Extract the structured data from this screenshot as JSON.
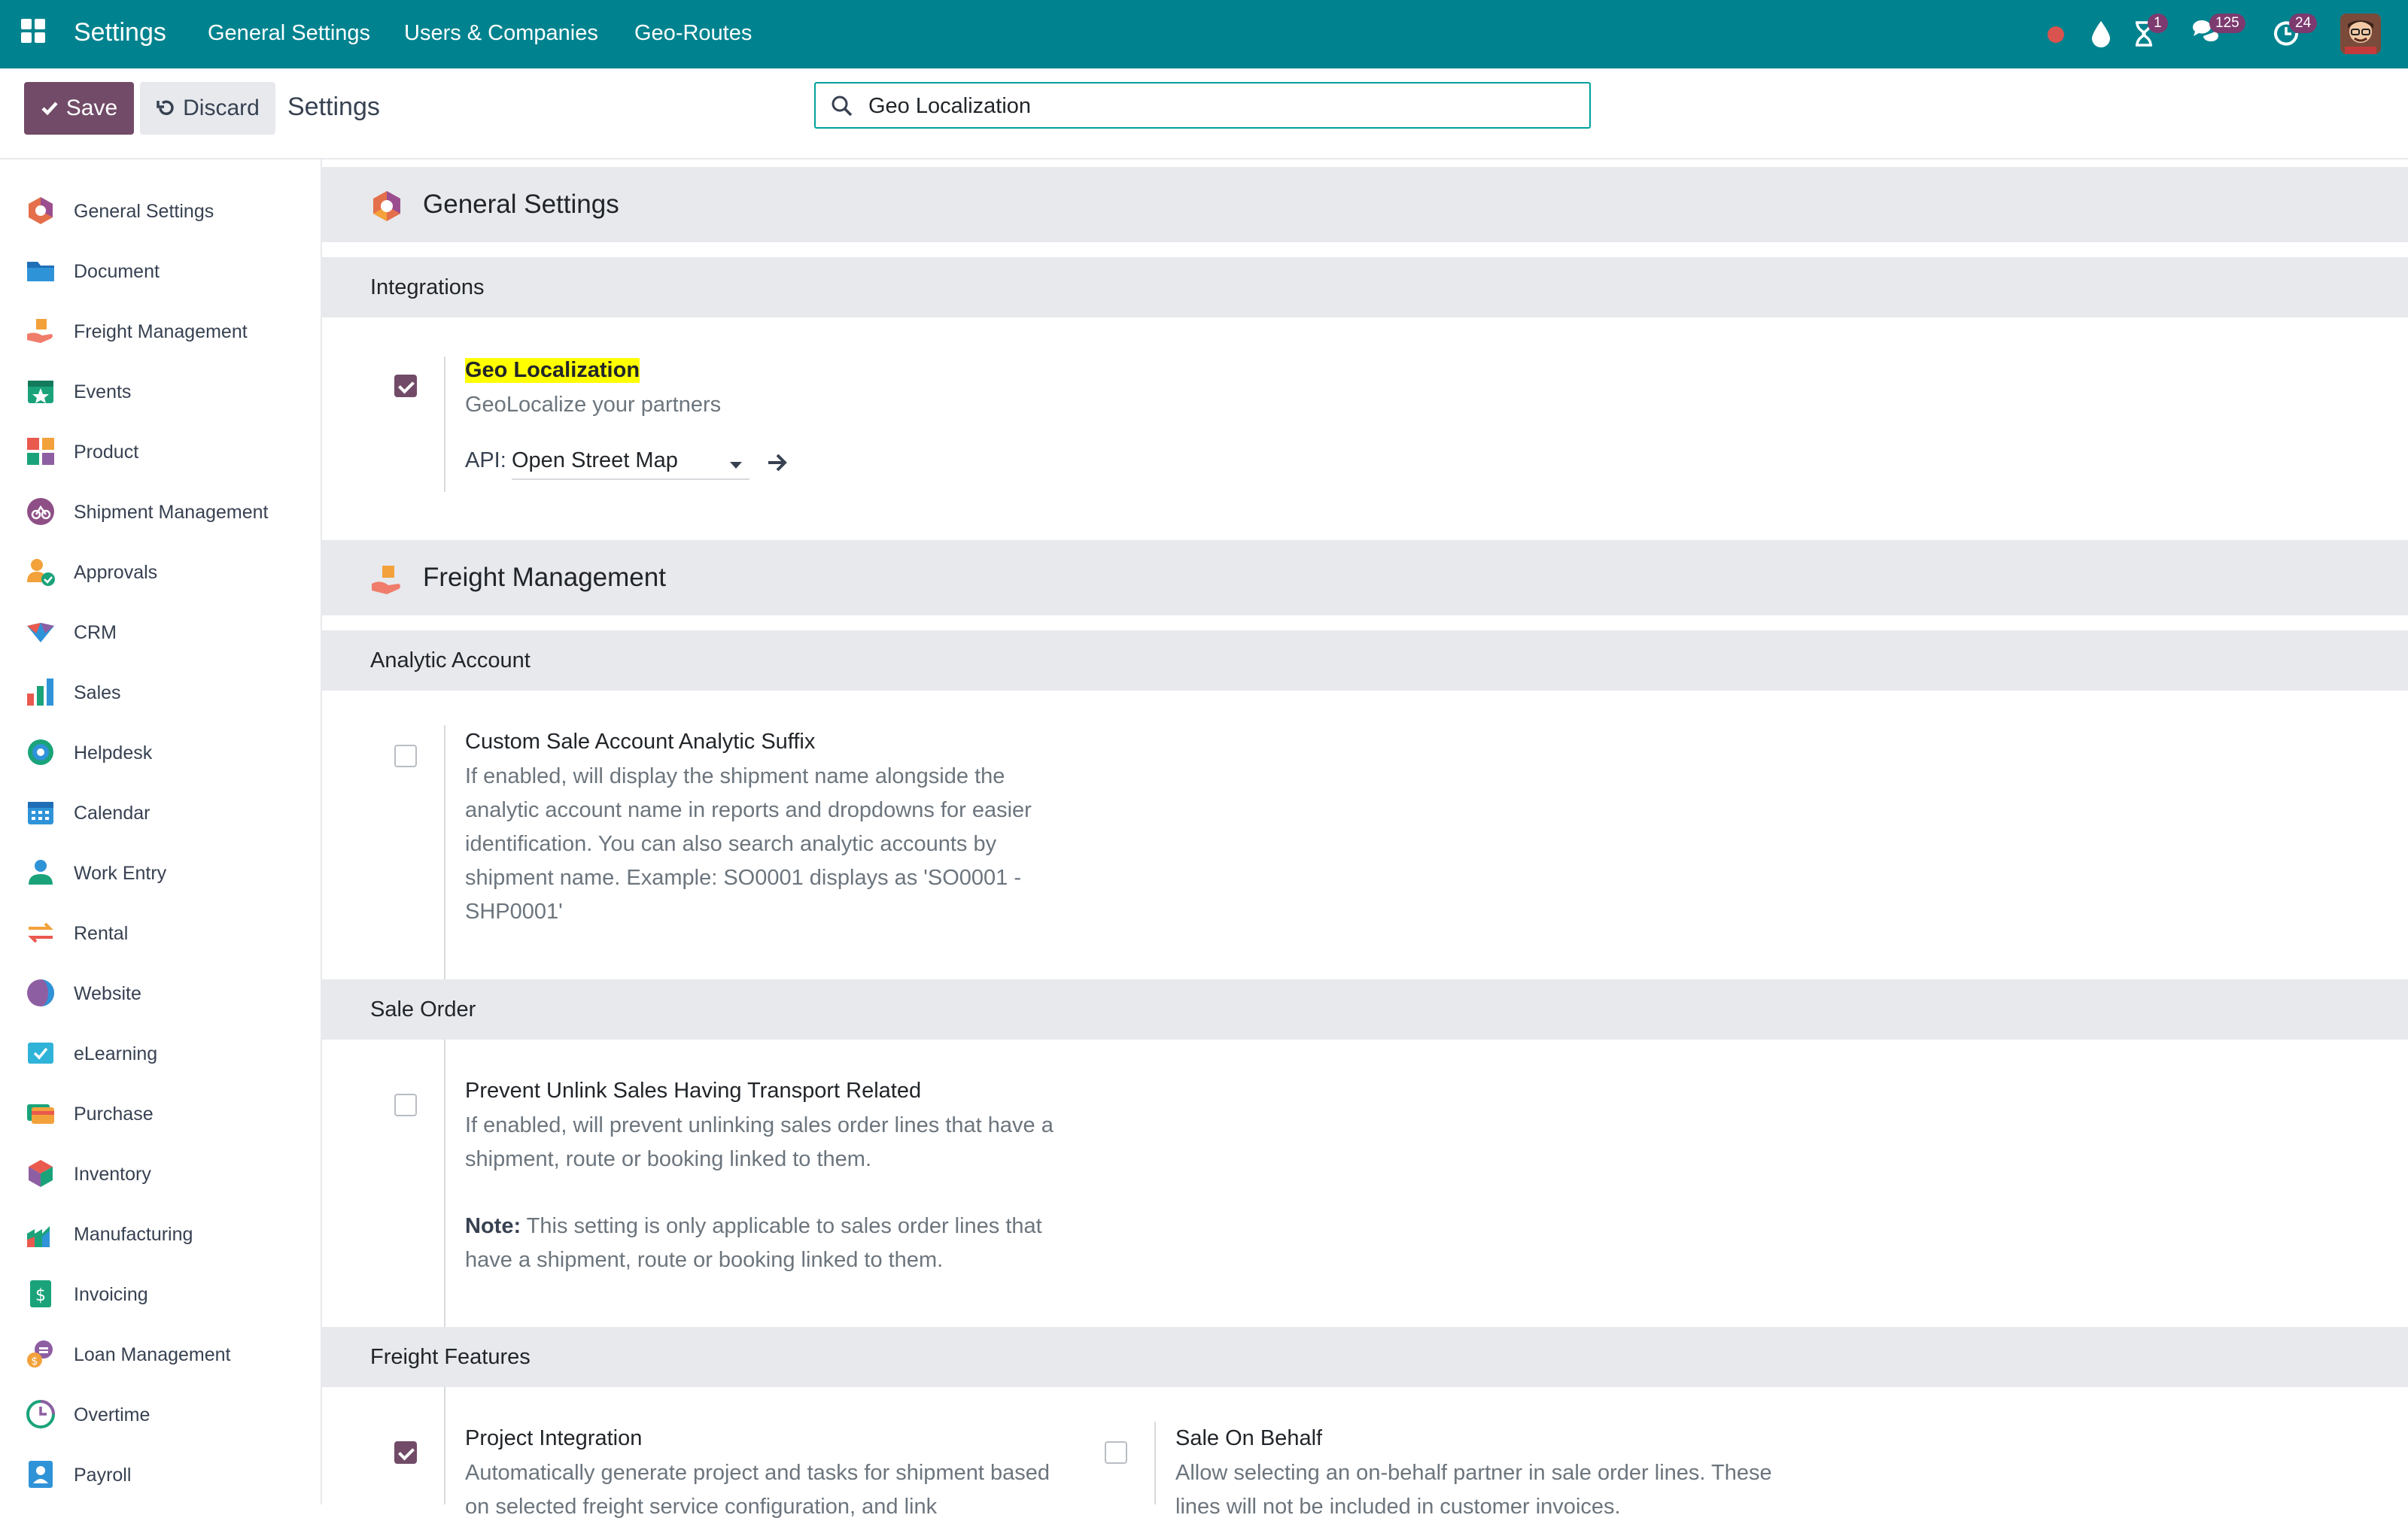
{
  "topbar": {
    "brand": "Settings",
    "menu": [
      "General Settings",
      "Users & Companies",
      "Geo-Routes"
    ],
    "badges": {
      "activities": "1",
      "messages": "125",
      "updates": "24"
    },
    "icons": [
      "apps-grid-icon",
      "record-dot-icon",
      "drop-icon",
      "hourglass-icon",
      "chat-icon",
      "refresh-clock-icon",
      "user-avatar"
    ]
  },
  "control": {
    "save_label": "Save",
    "discard_label": "Discard",
    "title": "Settings",
    "search_value": "Geo Localization"
  },
  "sidebar": {
    "items": [
      {
        "label": "General Settings",
        "icon": "general-settings-icon"
      },
      {
        "label": "Document",
        "icon": "folder-icon"
      },
      {
        "label": "Freight Management",
        "icon": "freight-icon"
      },
      {
        "label": "Events",
        "icon": "events-icon"
      },
      {
        "label": "Product",
        "icon": "product-icon"
      },
      {
        "label": "Shipment Management",
        "icon": "shipment-icon"
      },
      {
        "label": "Approvals",
        "icon": "approvals-icon"
      },
      {
        "label": "CRM",
        "icon": "crm-icon"
      },
      {
        "label": "Sales",
        "icon": "sales-icon"
      },
      {
        "label": "Helpdesk",
        "icon": "helpdesk-icon"
      },
      {
        "label": "Calendar",
        "icon": "calendar-icon"
      },
      {
        "label": "Work Entry",
        "icon": "work-entry-icon"
      },
      {
        "label": "Rental",
        "icon": "rental-icon"
      },
      {
        "label": "Website",
        "icon": "website-icon"
      },
      {
        "label": "eLearning",
        "icon": "elearning-icon"
      },
      {
        "label": "Purchase",
        "icon": "purchase-icon"
      },
      {
        "label": "Inventory",
        "icon": "inventory-icon"
      },
      {
        "label": "Manufacturing",
        "icon": "manufacturing-icon"
      },
      {
        "label": "Invoicing",
        "icon": "invoicing-icon"
      },
      {
        "label": "Loan Management",
        "icon": "loan-icon"
      },
      {
        "label": "Overtime",
        "icon": "overtime-icon"
      },
      {
        "label": "Payroll",
        "icon": "payroll-icon"
      }
    ]
  },
  "main": {
    "general_settings": {
      "title": "General Settings",
      "integrations": {
        "title": "Integrations",
        "geo": {
          "title": "Geo Localization",
          "desc": "GeoLocalize your partners",
          "checked": true,
          "api_label": "API:",
          "api_value": "Open Street Map"
        }
      }
    },
    "freight": {
      "title": "Freight Management",
      "analytic": {
        "title": "Analytic Account",
        "suffix": {
          "title": "Custom Sale Account Analytic Suffix",
          "desc": "If enabled, will display the shipment name alongside the analytic account name in reports and dropdowns for easier identification. You can also search analytic accounts by shipment name. Example: SO0001 displays as 'SO0001 - SHP0001'",
          "checked": false
        }
      },
      "sale_order": {
        "title": "Sale Order",
        "prevent": {
          "title": "Prevent Unlink Sales Having Transport Related",
          "desc": "If enabled, will prevent unlinking sales order lines that have a shipment, route or booking linked to them.",
          "note_label": "Note:",
          "note": "This setting is only applicable to sales order lines that have a shipment, route or booking linked to them.",
          "checked": false
        }
      },
      "features": {
        "title": "Freight Features",
        "project": {
          "title": "Project Integration",
          "desc": "Automatically generate project and tasks for shipment based on selected freight service configuration, and link",
          "checked": true
        },
        "behalf": {
          "title": "Sale On Behalf",
          "desc": "Allow selecting an on-behalf partner in sale order lines. These lines will not be included in customer invoices.",
          "checked": false
        }
      }
    }
  },
  "colors": {
    "topbar": "#00838f",
    "primary": "#714b67",
    "section_bg": "#e7e9ed",
    "highlight": "#ffff00"
  }
}
